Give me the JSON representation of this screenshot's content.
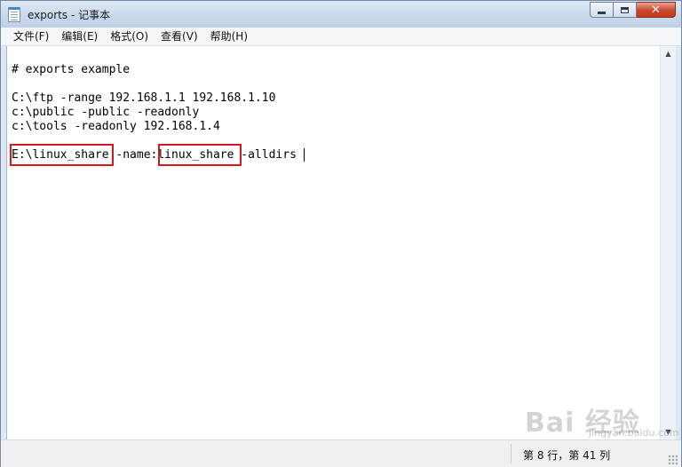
{
  "window": {
    "title": "exports - 记事本"
  },
  "menu": [
    {
      "label": "文件(F)"
    },
    {
      "label": "编辑(E)"
    },
    {
      "label": "格式(O)"
    },
    {
      "label": "查看(V)"
    },
    {
      "label": "帮助(H)"
    }
  ],
  "editor": {
    "lines": [
      "# exports example",
      "",
      "C:\\ftp -range 192.168.1.1 192.168.1.10",
      "c:\\public -public -readonly",
      "c:\\tools -readonly 192.168.1.4",
      "",
      "E:\\linux_share -name:linux_share -alldirs"
    ],
    "highlight_color": "#d6191f"
  },
  "status": {
    "position": "第 8 行，第 41 列"
  },
  "watermark": {
    "text": "Bai 经验",
    "sub": "jingyan.baidu.com"
  }
}
